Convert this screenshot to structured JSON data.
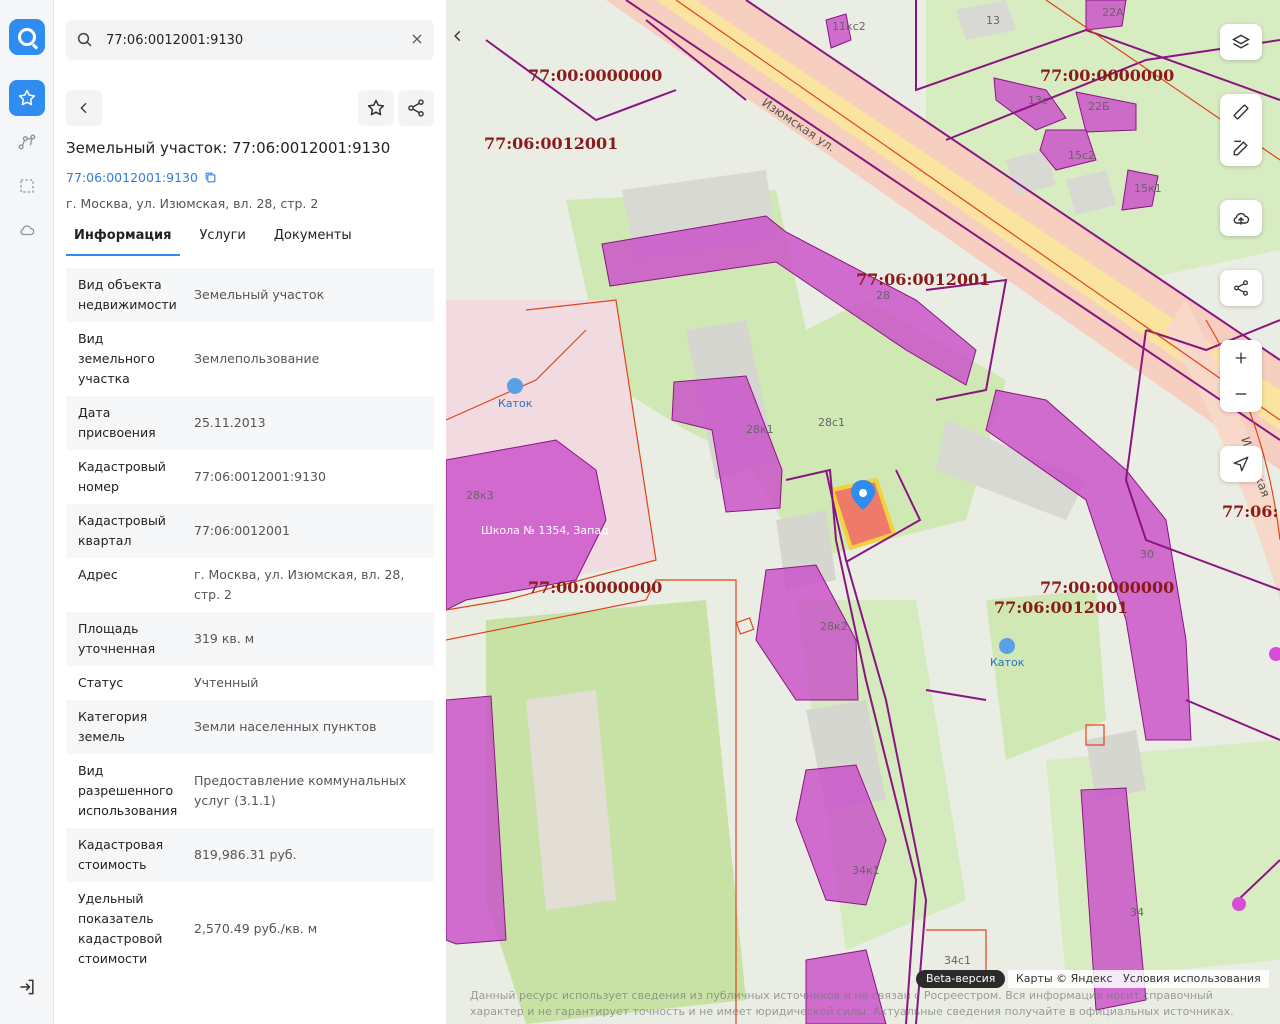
{
  "search": {
    "value": "77:06:0012001:9130"
  },
  "object": {
    "title": "Земельный участок: 77:06:0012001:9130",
    "cad_number": "77:06:0012001:9130",
    "address": "г. Москва, ул. Изюмская, вл. 28, стр. 2"
  },
  "tabs": [
    "Информация",
    "Услуги",
    "Документы"
  ],
  "info": [
    {
      "key": "Вид объекта недвижимости",
      "value": "Земельный участок"
    },
    {
      "key": "Вид земельного участка",
      "value": "Землепользование"
    },
    {
      "key": "Дата присвоения",
      "value": "25.11.2013"
    },
    {
      "key": "Кадастровый номер",
      "value": "77:06:0012001:9130"
    },
    {
      "key": "Кадастровый квартал",
      "value": "77:06:0012001"
    },
    {
      "key": "Адрес",
      "value": "г. Москва, ул. Изюмская, вл. 28, стр. 2"
    },
    {
      "key": "Площадь уточненная",
      "value": "319 кв. м"
    },
    {
      "key": "Статус",
      "value": "Учтенный"
    },
    {
      "key": "Категория земель",
      "value": "Земли населенных пунктов"
    },
    {
      "key": "Вид разрешенного использования",
      "value": "Предоставление коммунальных услуг (3.1.1)"
    },
    {
      "key": "Кадастровая стоимость",
      "value": "819,986.31 руб."
    },
    {
      "key": "Удельный показатель кадастровой стоимости",
      "value": "2,570.49 руб./кв. м"
    }
  ],
  "map": {
    "street": "Изюмская ул.",
    "cadastral_labels": [
      "77:00:0000000",
      "77:06:0012001",
      "77:00:0000000",
      "77:06:0012001",
      "77:00:0000000",
      "77:00:0000000",
      "77:06:0012001",
      "77:06:"
    ],
    "building_labels": [
      "13",
      "11кс2",
      "22А",
      "13с",
      "22Б",
      "15с2",
      "15к1",
      "28",
      "28к1",
      "28с1",
      "28к3",
      "30",
      "28к2",
      "34к1",
      "34",
      "34с1"
    ],
    "poi": [
      "Каток",
      "Каток",
      "Школа № 1354, Запад"
    ],
    "street_tail": "Изюмская",
    "beta": "Beta-версия",
    "copyright": "Карты © Яндекс",
    "terms": "Условия использования",
    "disclaimer": "Данный ресурс использует сведения из публичных источников и не связан с Росреестром. Вся информация носит справочный характер и не гарантирует точность и не имеет юридической силы. Актуальные сведения получайте в официальных источниках."
  },
  "colors": {
    "accent": "#2f8cf0",
    "building_fill": "#c94fc9",
    "parcel_line": "#8a1580",
    "quarter_line": "#e0441c",
    "selected_parcel": "#f07a6a"
  }
}
